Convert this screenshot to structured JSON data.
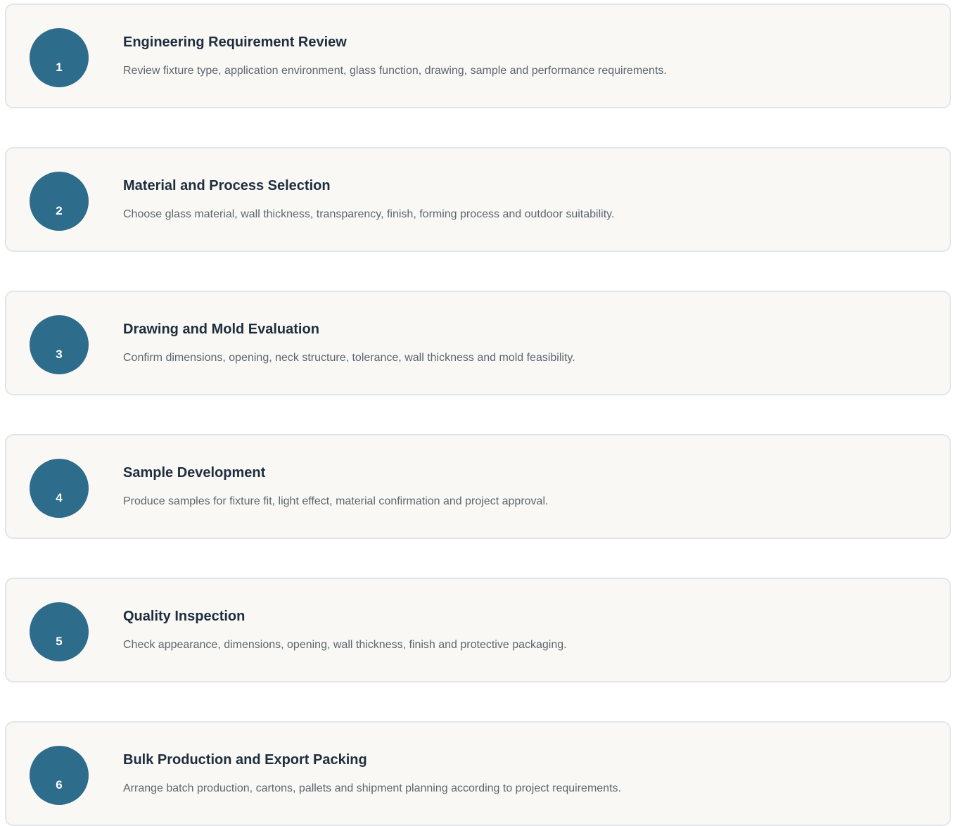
{
  "steps": [
    {
      "number": "1",
      "title": "Engineering Requirement Review",
      "description": "Review fixture type, application environment, glass function, drawing, sample and performance requirements."
    },
    {
      "number": "2",
      "title": "Material and Process Selection",
      "description": "Choose glass material, wall thickness, transparency, finish, forming process and outdoor suitability."
    },
    {
      "number": "3",
      "title": "Drawing and Mold Evaluation",
      "description": "Confirm dimensions, opening, neck structure, tolerance, wall thickness and mold feasibility."
    },
    {
      "number": "4",
      "title": "Sample Development",
      "description": "Produce samples for fixture fit, light effect, material confirmation and project approval."
    },
    {
      "number": "5",
      "title": "Quality Inspection",
      "description": "Check appearance, dimensions, opening, wall thickness, finish and protective packaging."
    },
    {
      "number": "6",
      "title": "Bulk Production and Export Packing",
      "description": "Arrange batch production, cartons, pallets and shipment planning according to project requirements."
    }
  ]
}
